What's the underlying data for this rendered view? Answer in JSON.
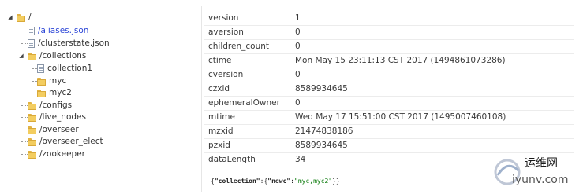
{
  "tree": {
    "root": "/",
    "items": [
      {
        "label": "/aliases.json",
        "type": "file",
        "selected": true
      },
      {
        "label": "/clusterstate.json",
        "type": "file"
      },
      {
        "label": "/collections",
        "type": "folder",
        "expanded": true
      },
      {
        "label": "collection1",
        "type": "file"
      },
      {
        "label": "myc",
        "type": "folder"
      },
      {
        "label": "myc2",
        "type": "folder"
      },
      {
        "label": "/configs",
        "type": "folder"
      },
      {
        "label": "/live_nodes",
        "type": "folder"
      },
      {
        "label": "/overseer",
        "type": "folder"
      },
      {
        "label": "/overseer_elect",
        "type": "folder"
      },
      {
        "label": "/zookeeper",
        "type": "folder"
      }
    ]
  },
  "properties": [
    {
      "key": "version",
      "value": "1"
    },
    {
      "key": "aversion",
      "value": "0"
    },
    {
      "key": "children_count",
      "value": "0"
    },
    {
      "key": "ctime",
      "value": "Mon May 15 23:11:13 CST 2017 (1494861073286)"
    },
    {
      "key": "cversion",
      "value": "0"
    },
    {
      "key": "czxid",
      "value": "8589934645"
    },
    {
      "key": "ephemeralOwner",
      "value": "0"
    },
    {
      "key": "mtime",
      "value": "Wed May 17 15:51:00 CST 2017 (1495007460108)"
    },
    {
      "key": "mzxid",
      "value": "21474838186"
    },
    {
      "key": "pzxid",
      "value": "8589934645"
    },
    {
      "key": "dataLength",
      "value": "34"
    }
  ],
  "json_content": {
    "open": "{",
    "key1": "\"collection\"",
    "sep1": ":{",
    "key2": "\"newc\"",
    "sep2": ":",
    "value": "\"myc,myc2\"",
    "close": "}}"
  },
  "watermark": {
    "line1": "运维网",
    "line2": "iyunv.com"
  }
}
